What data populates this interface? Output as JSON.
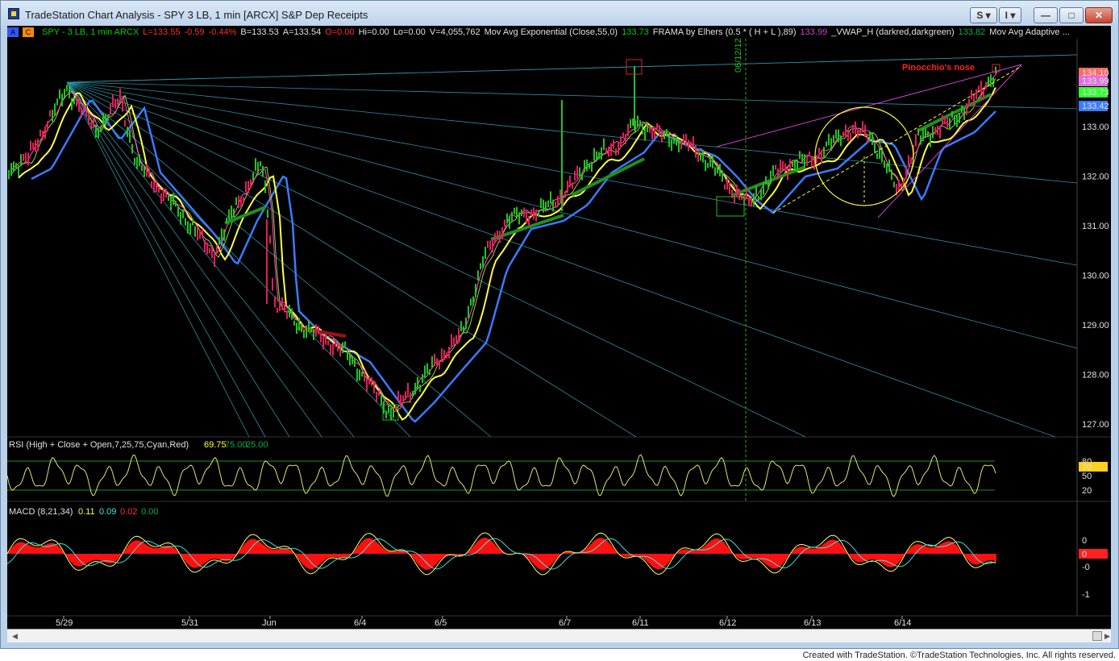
{
  "window": {
    "title": "TradeStation Chart Analysis - SPY 3 LB, 1 min [ARCX] S&P Dep Receipts"
  },
  "title_buttons": {
    "s_label": "S",
    "i_label": "I",
    "minimize": "—",
    "maximize": "□",
    "close": "✕"
  },
  "header_boxes": [
    {
      "label": "A",
      "color": "#3355ff"
    },
    {
      "label": "C",
      "color": "#ff8800"
    }
  ],
  "status_items": [
    {
      "text": "SPY - 3 LB, 1 min  ARCX",
      "color": "#00d000"
    },
    {
      "text": "L=133.55",
      "color": "#ff2a2a"
    },
    {
      "text": "-0.59",
      "color": "#ff2a2a"
    },
    {
      "text": "-0.44%",
      "color": "#ff2a2a"
    },
    {
      "text": "B=133.53",
      "color": "#e0e0e0"
    },
    {
      "text": "A=133.54",
      "color": "#e0e0e0"
    },
    {
      "text": "O=0.00",
      "color": "#ff2a2a"
    },
    {
      "text": "Hi=0.00",
      "color": "#e0e0e0"
    },
    {
      "text": "Lo=0.00",
      "color": "#e0e0e0"
    },
    {
      "text": "V=4,055,762",
      "color": "#e0e0e0"
    },
    {
      "text": "Mov Avg Exponential (Close,55,0)",
      "color": "#e0e0e0"
    },
    {
      "text": "133.73",
      "color": "#00d000"
    },
    {
      "text": "FRAMA by Elhers (0.5 * ( H + L ),89)",
      "color": "#e0e0e0"
    },
    {
      "text": "133.99",
      "color": "#d040d0"
    },
    {
      "text": "_VWAP_H (darkred,darkgreen)",
      "color": "#e0e0e0"
    },
    {
      "text": "133.82",
      "color": "#00b050"
    },
    {
      "text": "Mov Avg Adaptive ...",
      "color": "#e0e0e0"
    }
  ],
  "price_axis": {
    "labels": [
      "133.00",
      "132.00",
      "131.00",
      "130.00",
      "129.00",
      "128.00",
      "127.00"
    ]
  },
  "price_tags": [
    {
      "text": "134.10",
      "bg": "#ff6a6a",
      "fg": "#000000"
    },
    {
      "text": "133.99",
      "bg": "#e070e0",
      "fg": "#000000"
    },
    {
      "text": "133.73",
      "bg": "#30ff30",
      "fg": "#000000"
    },
    {
      "text": "133.42",
      "bg": "#3a7bff",
      "fg": "#ffffff"
    }
  ],
  "vertical_marker": {
    "label": "06/12/12"
  },
  "annotation": {
    "text": "Pinocchio's nose"
  },
  "rsi": {
    "label": "RSI (High + Close + Open,7,25,75,Cyan,Red)",
    "values": [
      "69.75",
      "75.00",
      "25.00"
    ],
    "value_colors": [
      "#ffff40",
      "#00b050",
      "#00b050"
    ],
    "axis": [
      "80",
      "50",
      "20"
    ],
    "tag": "70"
  },
  "macd": {
    "label": "MACD (8,21,34)",
    "values": [
      "0.11",
      "0.09",
      "0.02",
      "0.00"
    ],
    "value_colors": [
      "#ffff40",
      "#40e0e0",
      "#ff3030",
      "#00b050"
    ],
    "axis": [
      "0",
      "-0",
      "-1"
    ],
    "tag": "0"
  },
  "x_axis": {
    "labels": [
      "5/29",
      "5/31",
      "Jun",
      "6/4",
      "6/5",
      "6/7",
      "6/11",
      "6/12",
      "6/13",
      "6/14"
    ]
  },
  "footer": {
    "text": "Created with TradeStation. ©TradeStation Technologies, Inc. All rights reserved."
  }
}
